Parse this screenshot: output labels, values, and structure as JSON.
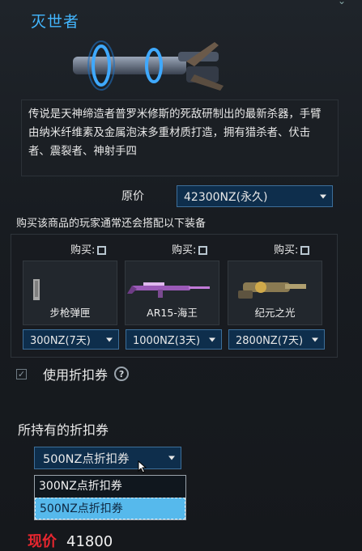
{
  "item": {
    "name": "灭世者",
    "description": "传说是天神缔造者普罗米修斯的死敌研制出的最新杀器，手臂由纳米纤维素及金属泡沫多重材质打造，拥有猎杀者、伏击者、震裂者、神射手四"
  },
  "price": {
    "label": "原价",
    "selected": "42300NZ(永久)"
  },
  "recommend": {
    "title": "购买该商品的玩家通常还会搭配以下装备",
    "buy_label": "购买:",
    "items": [
      {
        "name": "步枪弹匣",
        "price": "300NZ(7天)",
        "icon": "magazine-icon"
      },
      {
        "name": "AR15-海王",
        "price": "1000NZ(3天)",
        "icon": "rifle-icon"
      },
      {
        "name": "纪元之光",
        "price": "2800NZ(7天)",
        "icon": "launcher-icon"
      }
    ]
  },
  "coupon": {
    "use_label": "使用折扣券",
    "help_icon": "help-icon",
    "held_title": "所持有的折扣券",
    "selected": "500NZ点折扣券",
    "options": [
      "300NZ点折扣券",
      "500NZ点折扣券"
    ]
  },
  "final": {
    "label": "现价",
    "value": "41800"
  },
  "colors": {
    "accent": "#43b7ff",
    "select_bg": "#0e2e4c",
    "highlight": "#56b9ec",
    "price_red": "#e8262f"
  }
}
